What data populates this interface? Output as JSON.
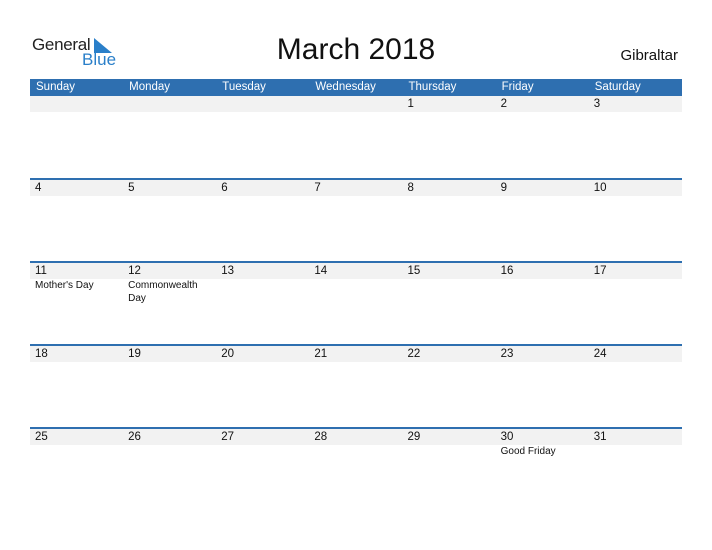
{
  "logo": {
    "word1": "General",
    "word2": "Blue",
    "accent_color": "#2a7fc9"
  },
  "header": {
    "title": "March 2018",
    "country": "Gibraltar"
  },
  "colors": {
    "header_bg": "#2e6fb0",
    "date_strip_bg": "#f2f2f2"
  },
  "weekdays": [
    "Sunday",
    "Monday",
    "Tuesday",
    "Wednesday",
    "Thursday",
    "Friday",
    "Saturday"
  ],
  "weeks": [
    {
      "days": [
        {
          "num": "",
          "event": ""
        },
        {
          "num": "",
          "event": ""
        },
        {
          "num": "",
          "event": ""
        },
        {
          "num": "",
          "event": ""
        },
        {
          "num": "1",
          "event": ""
        },
        {
          "num": "2",
          "event": ""
        },
        {
          "num": "3",
          "event": ""
        }
      ]
    },
    {
      "days": [
        {
          "num": "4",
          "event": ""
        },
        {
          "num": "5",
          "event": ""
        },
        {
          "num": "6",
          "event": ""
        },
        {
          "num": "7",
          "event": ""
        },
        {
          "num": "8",
          "event": ""
        },
        {
          "num": "9",
          "event": ""
        },
        {
          "num": "10",
          "event": ""
        }
      ]
    },
    {
      "days": [
        {
          "num": "11",
          "event": "Mother's Day"
        },
        {
          "num": "12",
          "event": "Commonwealth Day"
        },
        {
          "num": "13",
          "event": ""
        },
        {
          "num": "14",
          "event": ""
        },
        {
          "num": "15",
          "event": ""
        },
        {
          "num": "16",
          "event": ""
        },
        {
          "num": "17",
          "event": ""
        }
      ]
    },
    {
      "days": [
        {
          "num": "18",
          "event": ""
        },
        {
          "num": "19",
          "event": ""
        },
        {
          "num": "20",
          "event": ""
        },
        {
          "num": "21",
          "event": ""
        },
        {
          "num": "22",
          "event": ""
        },
        {
          "num": "23",
          "event": ""
        },
        {
          "num": "24",
          "event": ""
        }
      ]
    },
    {
      "days": [
        {
          "num": "25",
          "event": ""
        },
        {
          "num": "26",
          "event": ""
        },
        {
          "num": "27",
          "event": ""
        },
        {
          "num": "28",
          "event": ""
        },
        {
          "num": "29",
          "event": ""
        },
        {
          "num": "30",
          "event": "Good Friday"
        },
        {
          "num": "31",
          "event": ""
        }
      ]
    }
  ]
}
